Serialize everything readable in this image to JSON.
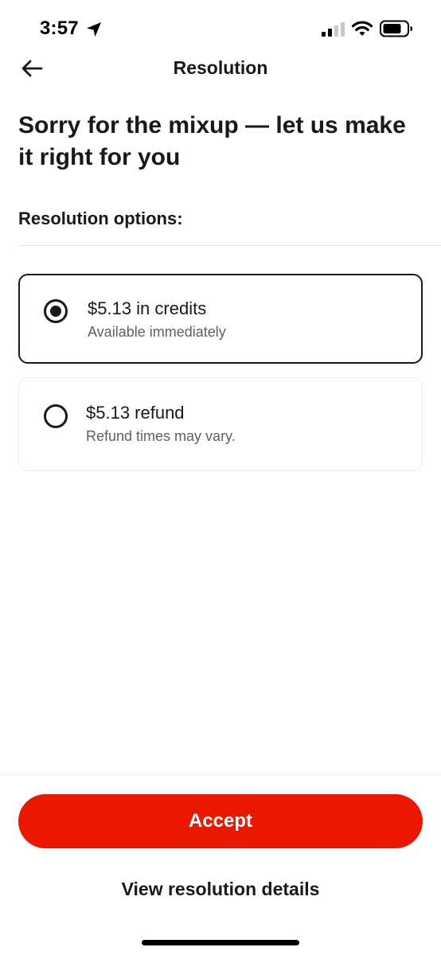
{
  "status_bar": {
    "time": "3:57",
    "icons": [
      "location-arrow-icon",
      "cellular-signal-icon",
      "wifi-icon",
      "battery-icon"
    ]
  },
  "header": {
    "back_icon": "arrow-left-icon",
    "title": "Resolution"
  },
  "headline": "Sorry for the mixup — let us make it right for you",
  "options_label": "Resolution options:",
  "options": [
    {
      "title": "$5.13 in credits",
      "subtitle": "Available immediately",
      "selected": true
    },
    {
      "title": "$5.13 refund",
      "subtitle": "Refund times may vary.",
      "selected": false
    }
  ],
  "actions": {
    "accept_label": "Accept",
    "details_label": "View resolution details"
  },
  "colors": {
    "accent": "#eb1700",
    "text": "#191919",
    "muted": "#606060"
  }
}
